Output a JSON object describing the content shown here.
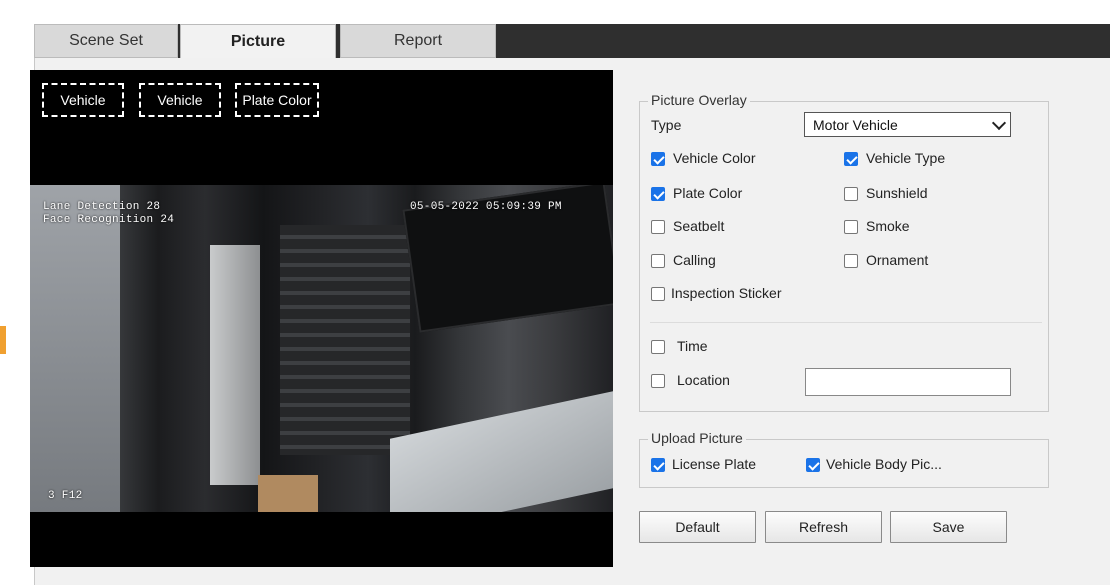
{
  "tabs": [
    {
      "label": "Scene Set",
      "active": false
    },
    {
      "label": "Picture",
      "active": true
    },
    {
      "label": "Report",
      "active": false
    }
  ],
  "preview": {
    "overlay_boxes": [
      "Vehicle",
      "Vehicle",
      "Plate Color"
    ],
    "osd": {
      "timestamp": "05-05-2022 05:09:39 PM",
      "counter_top": "Lane Detection 28",
      "counter_bottom": "Face Recognition 24",
      "corner": "3 F12"
    }
  },
  "picture_overlay": {
    "legend": "Picture Overlay",
    "type_label": "Type",
    "type_value": "Motor Vehicle",
    "options": [
      {
        "label": "Vehicle Color",
        "checked": true
      },
      {
        "label": "Vehicle Type",
        "checked": true
      },
      {
        "label": "Plate Color",
        "checked": true
      },
      {
        "label": "Sunshield",
        "checked": false
      },
      {
        "label": "Seatbelt",
        "checked": false
      },
      {
        "label": "Smoke",
        "checked": false
      },
      {
        "label": "Calling",
        "checked": false
      },
      {
        "label": "Ornament",
        "checked": false
      },
      {
        "label": "Inspection Sticker",
        "checked": false
      }
    ],
    "time_label": "Time",
    "time_checked": false,
    "location_label": "Location",
    "location_checked": false,
    "location_value": ""
  },
  "upload_picture": {
    "legend": "Upload Picture",
    "options": [
      {
        "label": "License Plate",
        "checked": true
      },
      {
        "label": "Vehicle Body Pic...",
        "checked": true
      }
    ]
  },
  "buttons": {
    "default_label": "Default",
    "refresh_label": "Refresh",
    "save_label": "Save"
  },
  "colors": {
    "accent": "#1a73e8",
    "tab_bar": "#2f2f2f",
    "panel_bg": "#f1f1f1",
    "side_marker": "#f0a030"
  }
}
